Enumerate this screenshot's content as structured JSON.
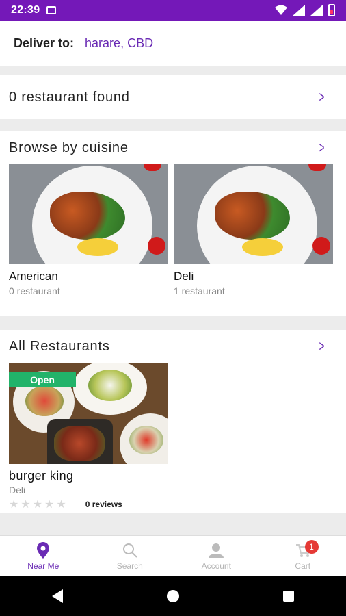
{
  "status_bar": {
    "time": "22:39"
  },
  "deliver": {
    "label": "Deliver to:",
    "location": "harare, CBD"
  },
  "found": {
    "title": "0 restaurant found"
  },
  "cuisine_section": {
    "title": "Browse by cuisine",
    "items": [
      {
        "name": "American",
        "count": "0 restaurant"
      },
      {
        "name": "Deli",
        "count": "1 restaurant"
      }
    ]
  },
  "restaurants_section": {
    "title": "All Restaurants",
    "items": [
      {
        "badge": "Open",
        "name": "burger king",
        "category": "Deli",
        "rating": 0,
        "reviews": "0 reviews"
      }
    ]
  },
  "tabs": [
    {
      "label": "Near Me",
      "icon": "location-pin-icon",
      "active": true
    },
    {
      "label": "Search",
      "icon": "search-icon",
      "active": false
    },
    {
      "label": "Account",
      "icon": "account-icon",
      "active": false
    },
    {
      "label": "Cart",
      "icon": "cart-icon",
      "active": false,
      "badge": "1"
    }
  ],
  "colors": {
    "accent": "#6a2bb4",
    "status_bar": "#7418b8",
    "open_badge": "#22b36a",
    "cart_badge": "#e53935"
  }
}
